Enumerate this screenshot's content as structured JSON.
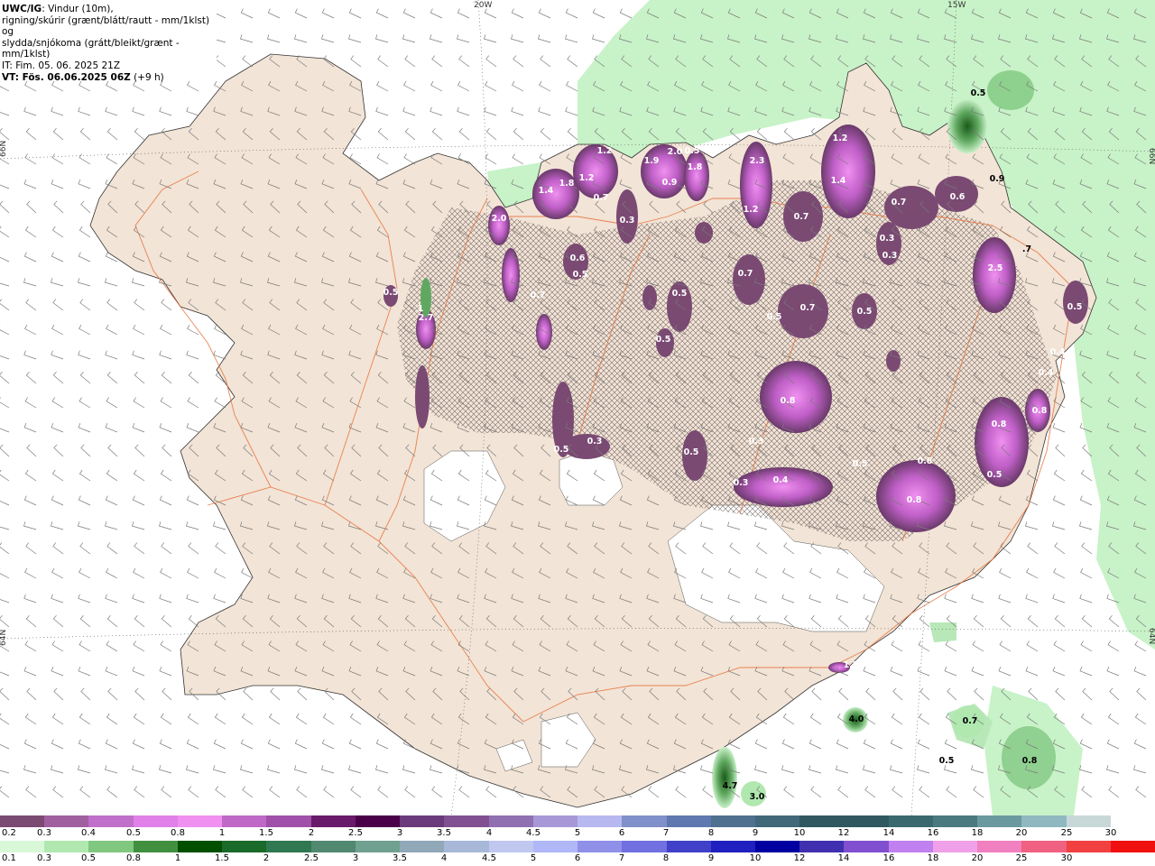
{
  "header": {
    "product": "UWC/IG",
    "line1_rest": ": Vindur (10m),",
    "line2": "rigning/skúrir (grænt/blátt/rautt - mm/1klst) og",
    "line3": "slydda/snjókoma (grátt/bleikt/grænt - mm/1klst)",
    "init_time": "IT: Fim. 05. 06. 2025 21Z",
    "valid_prefix": "VT:",
    "valid_time": " Fös. 06.06.2025 06Z",
    "valid_offset": " (+9 h)"
  },
  "graticule": {
    "top_labels": [
      "20W",
      "15W"
    ],
    "left_labels": [
      "66N",
      "64N"
    ],
    "right_labels": [
      "66N",
      "64N"
    ]
  },
  "value_labels": [
    {
      "text": "2.7"
    },
    {
      "text": "1"
    },
    {
      "text": "0.5"
    },
    {
      "text": "2.0"
    },
    {
      "text": "0.7"
    },
    {
      "text": "1.4"
    },
    {
      "text": "1.8"
    },
    {
      "text": "1.2"
    },
    {
      "text": "0.7"
    },
    {
      "text": "1.2"
    },
    {
      "text": "1.9"
    },
    {
      "text": "2.0"
    },
    {
      "text": "1.8"
    },
    {
      "text": "0.9"
    },
    {
      "text": "2.3"
    },
    {
      "text": "1.2"
    },
    {
      "text": "1.2"
    },
    {
      "text": "1.4"
    },
    {
      "text": "0.7"
    },
    {
      "text": "0.7"
    },
    {
      "text": "0.6"
    },
    {
      "text": "0.3"
    },
    {
      "text": "0.3"
    },
    {
      "text": "2.5"
    },
    {
      "text": "0.5"
    },
    {
      "text": "0.7"
    },
    {
      "text": "0.5"
    },
    {
      "text": "0.5"
    },
    {
      "text": "0.3"
    },
    {
      "text": "0.5"
    },
    {
      "text": "0.7"
    },
    {
      "text": "0.5"
    },
    {
      "text": "0.3"
    },
    {
      "text": "0.5"
    },
    {
      "text": "0.8"
    },
    {
      "text": "0.3"
    },
    {
      "text": "0.4"
    },
    {
      "text": "0.5"
    },
    {
      "text": "0.3"
    },
    {
      "text": "0.4"
    },
    {
      "text": "0.4"
    },
    {
      "text": "0.8"
    },
    {
      "text": "0.8"
    },
    {
      "text": "0.5"
    },
    {
      "text": "0.8"
    },
    {
      "text": "0.8"
    },
    {
      "text": "0.5"
    },
    {
      "text": "0.5"
    },
    {
      "text": "1.2"
    },
    {
      "text": "4.0"
    },
    {
      "text": "0.7"
    },
    {
      "text": "0.5"
    },
    {
      "text": "0.8"
    },
    {
      "text": "4.7"
    },
    {
      "text": "3.0"
    },
    {
      "text": "0.5"
    },
    {
      "text": "0.9"
    },
    {
      "text": ".7"
    },
    {
      "text": "0.5"
    },
    {
      "text": "0.6"
    }
  ],
  "legend_snow": {
    "labels": [
      "0.2",
      "0.3",
      "0.4",
      "0.5",
      "0.8",
      "1",
      "1.5",
      "2",
      "2.5",
      "3",
      "3.5",
      "4",
      "4.5",
      "5",
      "6",
      "7",
      "8",
      "9",
      "10",
      "12",
      "14",
      "16",
      "18",
      "20",
      "25",
      "30"
    ],
    "colors": [
      "#7a4a73",
      "#a060a0",
      "#c070c8",
      "#e080e8",
      "#f090f0",
      "#c068c8",
      "#a050a8",
      "#6a1a6a",
      "#4a0048",
      "#6a3a7a",
      "#805090",
      "#9070b0",
      "#a898d8",
      "#b8b8f0",
      "#8090c8",
      "#6078b0",
      "#507090",
      "#406878",
      "#305860",
      "#305860",
      "#3a6a70",
      "#4a7a80",
      "#6a9aa0",
      "#90b8c0",
      "#c8d8d8",
      "#ffffff"
    ]
  },
  "legend_rain": {
    "labels": [
      "0.1",
      "0.3",
      "0.5",
      "0.8",
      "1",
      "1.5",
      "2",
      "2.5",
      "3",
      "3.5",
      "4",
      "4.5",
      "5",
      "6",
      "7",
      "8",
      "9",
      "10",
      "12",
      "14",
      "16",
      "18",
      "20",
      "25",
      "30"
    ],
    "colors": [
      "#d8f8d8",
      "#b0e8b0",
      "#80c880",
      "#409040",
      "#005000",
      "#1a6a2a",
      "#307850",
      "#508870",
      "#70a090",
      "#90a8b8",
      "#a8b8d8",
      "#c0c8f0",
      "#b0b8f8",
      "#9090e8",
      "#7070e0",
      "#4040c8",
      "#2020c0",
      "#0000a0",
      "#4030b0",
      "#8050d0",
      "#c080f0",
      "#f0a0e8",
      "#f080c0",
      "#f06080",
      "#f04040",
      "#f01010"
    ]
  },
  "colors": {
    "land": "#f2e4d6",
    "sea": "#ffffff",
    "glacier": "#ffffff",
    "roads": "#e8703a",
    "snow_light": "#e080e8",
    "snow_dark": "#6a3a6a",
    "rain_light": "#d8f8d8",
    "rain_dark": "#2a6a2a"
  }
}
